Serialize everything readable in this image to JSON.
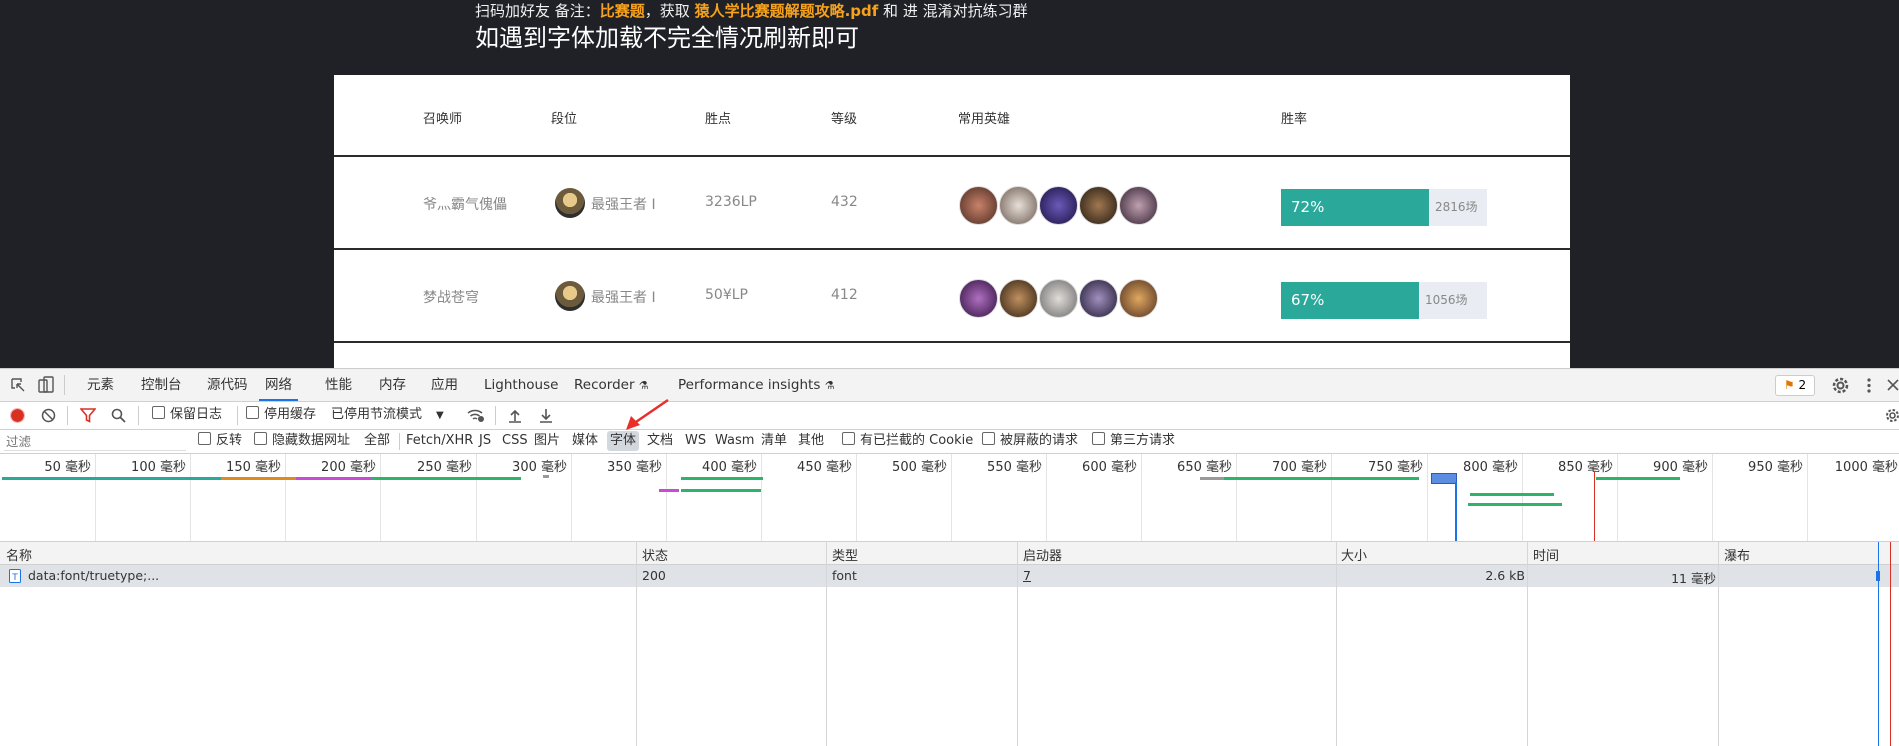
{
  "page": {
    "announcement": {
      "part1": "扫码加好友 备注：",
      "hl1": "比赛题",
      "part2": "，获取 ",
      "hl2": "猿人学比赛题解题攻略.pdf",
      "part3": " 和 进 混淆对抗练习群"
    },
    "notice": "如遇到字体加载不完全情况刷新即可",
    "table": {
      "headers": [
        "召唤师",
        "段位",
        "胜点",
        "等级",
        "常用英雄",
        "胜率"
      ],
      "rows": [
        {
          "name": "爷灬霸气傀儡",
          "tier": "最强王者 I",
          "lp": "3236LP",
          "level": "432",
          "win_rate": "72%",
          "win_rate_value": 0.72,
          "games": "2816场"
        },
        {
          "name": "梦战苍穹",
          "tier": "最强王者 I",
          "lp": "50¥LP",
          "level": "412",
          "win_rate": "67%",
          "win_rate_value": 0.67,
          "games": "1056场"
        }
      ]
    }
  },
  "devtools": {
    "tabs": [
      "元素",
      "控制台",
      "源代码",
      "网络",
      "性能",
      "内存",
      "应用",
      "Lighthouse",
      "Recorder",
      "Performance insights"
    ],
    "active_tab": "网络",
    "issues_badge": "2",
    "toolbar": {
      "preserve_log": "保留日志",
      "disable_cache": "停用缓存",
      "throttle": "已停用节流模式"
    },
    "filter": {
      "placeholder": "过滤",
      "invert": "反转",
      "hide_data_urls": "隐藏数据网址",
      "types": [
        "全部",
        "Fetch/XHR",
        "JS",
        "CSS",
        "图片",
        "媒体",
        "字体",
        "文档",
        "WS",
        "Wasm",
        "清单",
        "其他"
      ],
      "active_type": "字体",
      "blocked_cookies": "有已拦截的 Cookie",
      "blocked_requests": "被屏蔽的请求",
      "third_party": "第三方请求"
    },
    "timeline_ticks": [
      "50 毫秒",
      "100 毫秒",
      "150 毫秒",
      "200 毫秒",
      "250 毫秒",
      "300 毫秒",
      "350 毫秒",
      "400 毫秒",
      "450 毫秒",
      "500 毫秒",
      "550 毫秒",
      "600 毫秒",
      "650 毫秒",
      "700 毫秒",
      "750 毫秒",
      "800 毫秒",
      "850 毫秒",
      "900 毫秒",
      "950 毫秒",
      "1000 毫秒"
    ],
    "columns": [
      "名称",
      "状态",
      "类型",
      "启动器",
      "大小",
      "时间",
      "瀑布"
    ],
    "requests": [
      {
        "name": "data:font/truetype;...",
        "status": "200",
        "type": "font",
        "initiator": "7",
        "size": "2.6 kB",
        "time": "11 毫秒"
      }
    ],
    "colors": {
      "accent": "#1a73e8",
      "record": "#d93025",
      "win_bar": "#2aa99b",
      "highlight": "#f6a21c"
    }
  }
}
